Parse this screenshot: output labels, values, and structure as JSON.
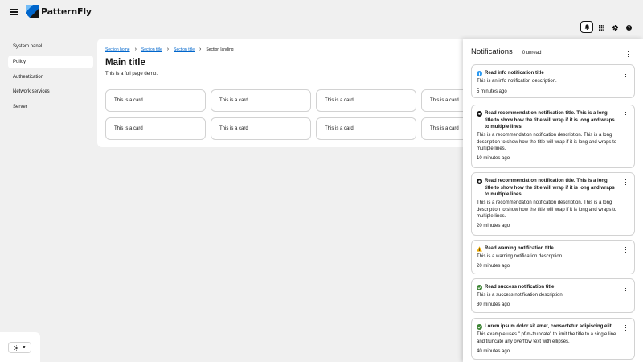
{
  "masthead": {
    "brand": "PatternFly",
    "colors": {
      "brand_dark": "#151515",
      "brand_blue": "#0066cc",
      "brand_light": "#73bcf7"
    },
    "tools": [
      "bell-icon",
      "grid-icon",
      "gear-icon",
      "help-icon"
    ]
  },
  "sidebar": {
    "items": [
      {
        "label": "System panel",
        "current": false
      },
      {
        "label": "Policy",
        "current": true
      },
      {
        "label": "Authentication",
        "current": false
      },
      {
        "label": "Network services",
        "current": false
      },
      {
        "label": "Server",
        "current": false
      }
    ]
  },
  "theme_toggle": {
    "icon": "sun-icon",
    "caret_icon": "caret-down-icon"
  },
  "main": {
    "breadcrumb": [
      "Section home",
      "Section title",
      "Section title",
      "Section landing"
    ],
    "title": "Main title",
    "description": "This is a full page demo.",
    "cards": [
      "This is a card",
      "This is a card",
      "This is a card",
      "This is a card",
      "This is a card",
      "This is a card",
      "This is a card",
      "This is a card"
    ]
  },
  "drawer": {
    "title": "Notifications",
    "unread": "0 unread",
    "notifications": [
      {
        "variant": "info",
        "icon": "info-circle-icon",
        "color": "#2b9af3",
        "title": "Read info notification title",
        "description": "This is an info notification description.",
        "time": "5 minutes ago"
      },
      {
        "variant": "recommendation",
        "icon": "recommendation-circle-icon",
        "color": "#151515",
        "title": "Read recommendation notification title. This is a long title to show how the title will wrap if it is long and wraps to multiple lines.",
        "description": "This is a recommendation notification description. This is a long description to show how the title will wrap if it is long and wraps to multiple lines.",
        "time": "10 minutes ago"
      },
      {
        "variant": "recommendation",
        "icon": "recommendation-circle-icon",
        "color": "#151515",
        "title": "Read recommendation notification title. This is a long title to show how the title will wrap if it is long and wraps to multiple lines.",
        "description": "This is a recommendation notification description. This is a long description to show how the title will wrap if it is long and wraps to multiple lines.",
        "time": "20 minutes ago"
      },
      {
        "variant": "warning",
        "icon": "warning-triangle-icon",
        "color": "#f0ab00",
        "title": "Read warning notification title",
        "description": "This is a warning notification description.",
        "time": "20 minutes ago"
      },
      {
        "variant": "success",
        "icon": "check-circle-icon",
        "color": "#3e8635",
        "title": "Read success notification title",
        "description": "This is a success notification description.",
        "time": "30 minutes ago"
      },
      {
        "variant": "success",
        "icon": "check-circle-icon",
        "color": "#3e8635",
        "title": "Lorem ipsum dolor sit amet, consectetur adipiscing elit. Sed hendrerit nisi in cursus maximus.",
        "description": "This example uses \" pf-m-truncate\" to limit the title to a single line and truncate any overflow text with ellipses.",
        "time": "40 minutes ago"
      }
    ]
  }
}
